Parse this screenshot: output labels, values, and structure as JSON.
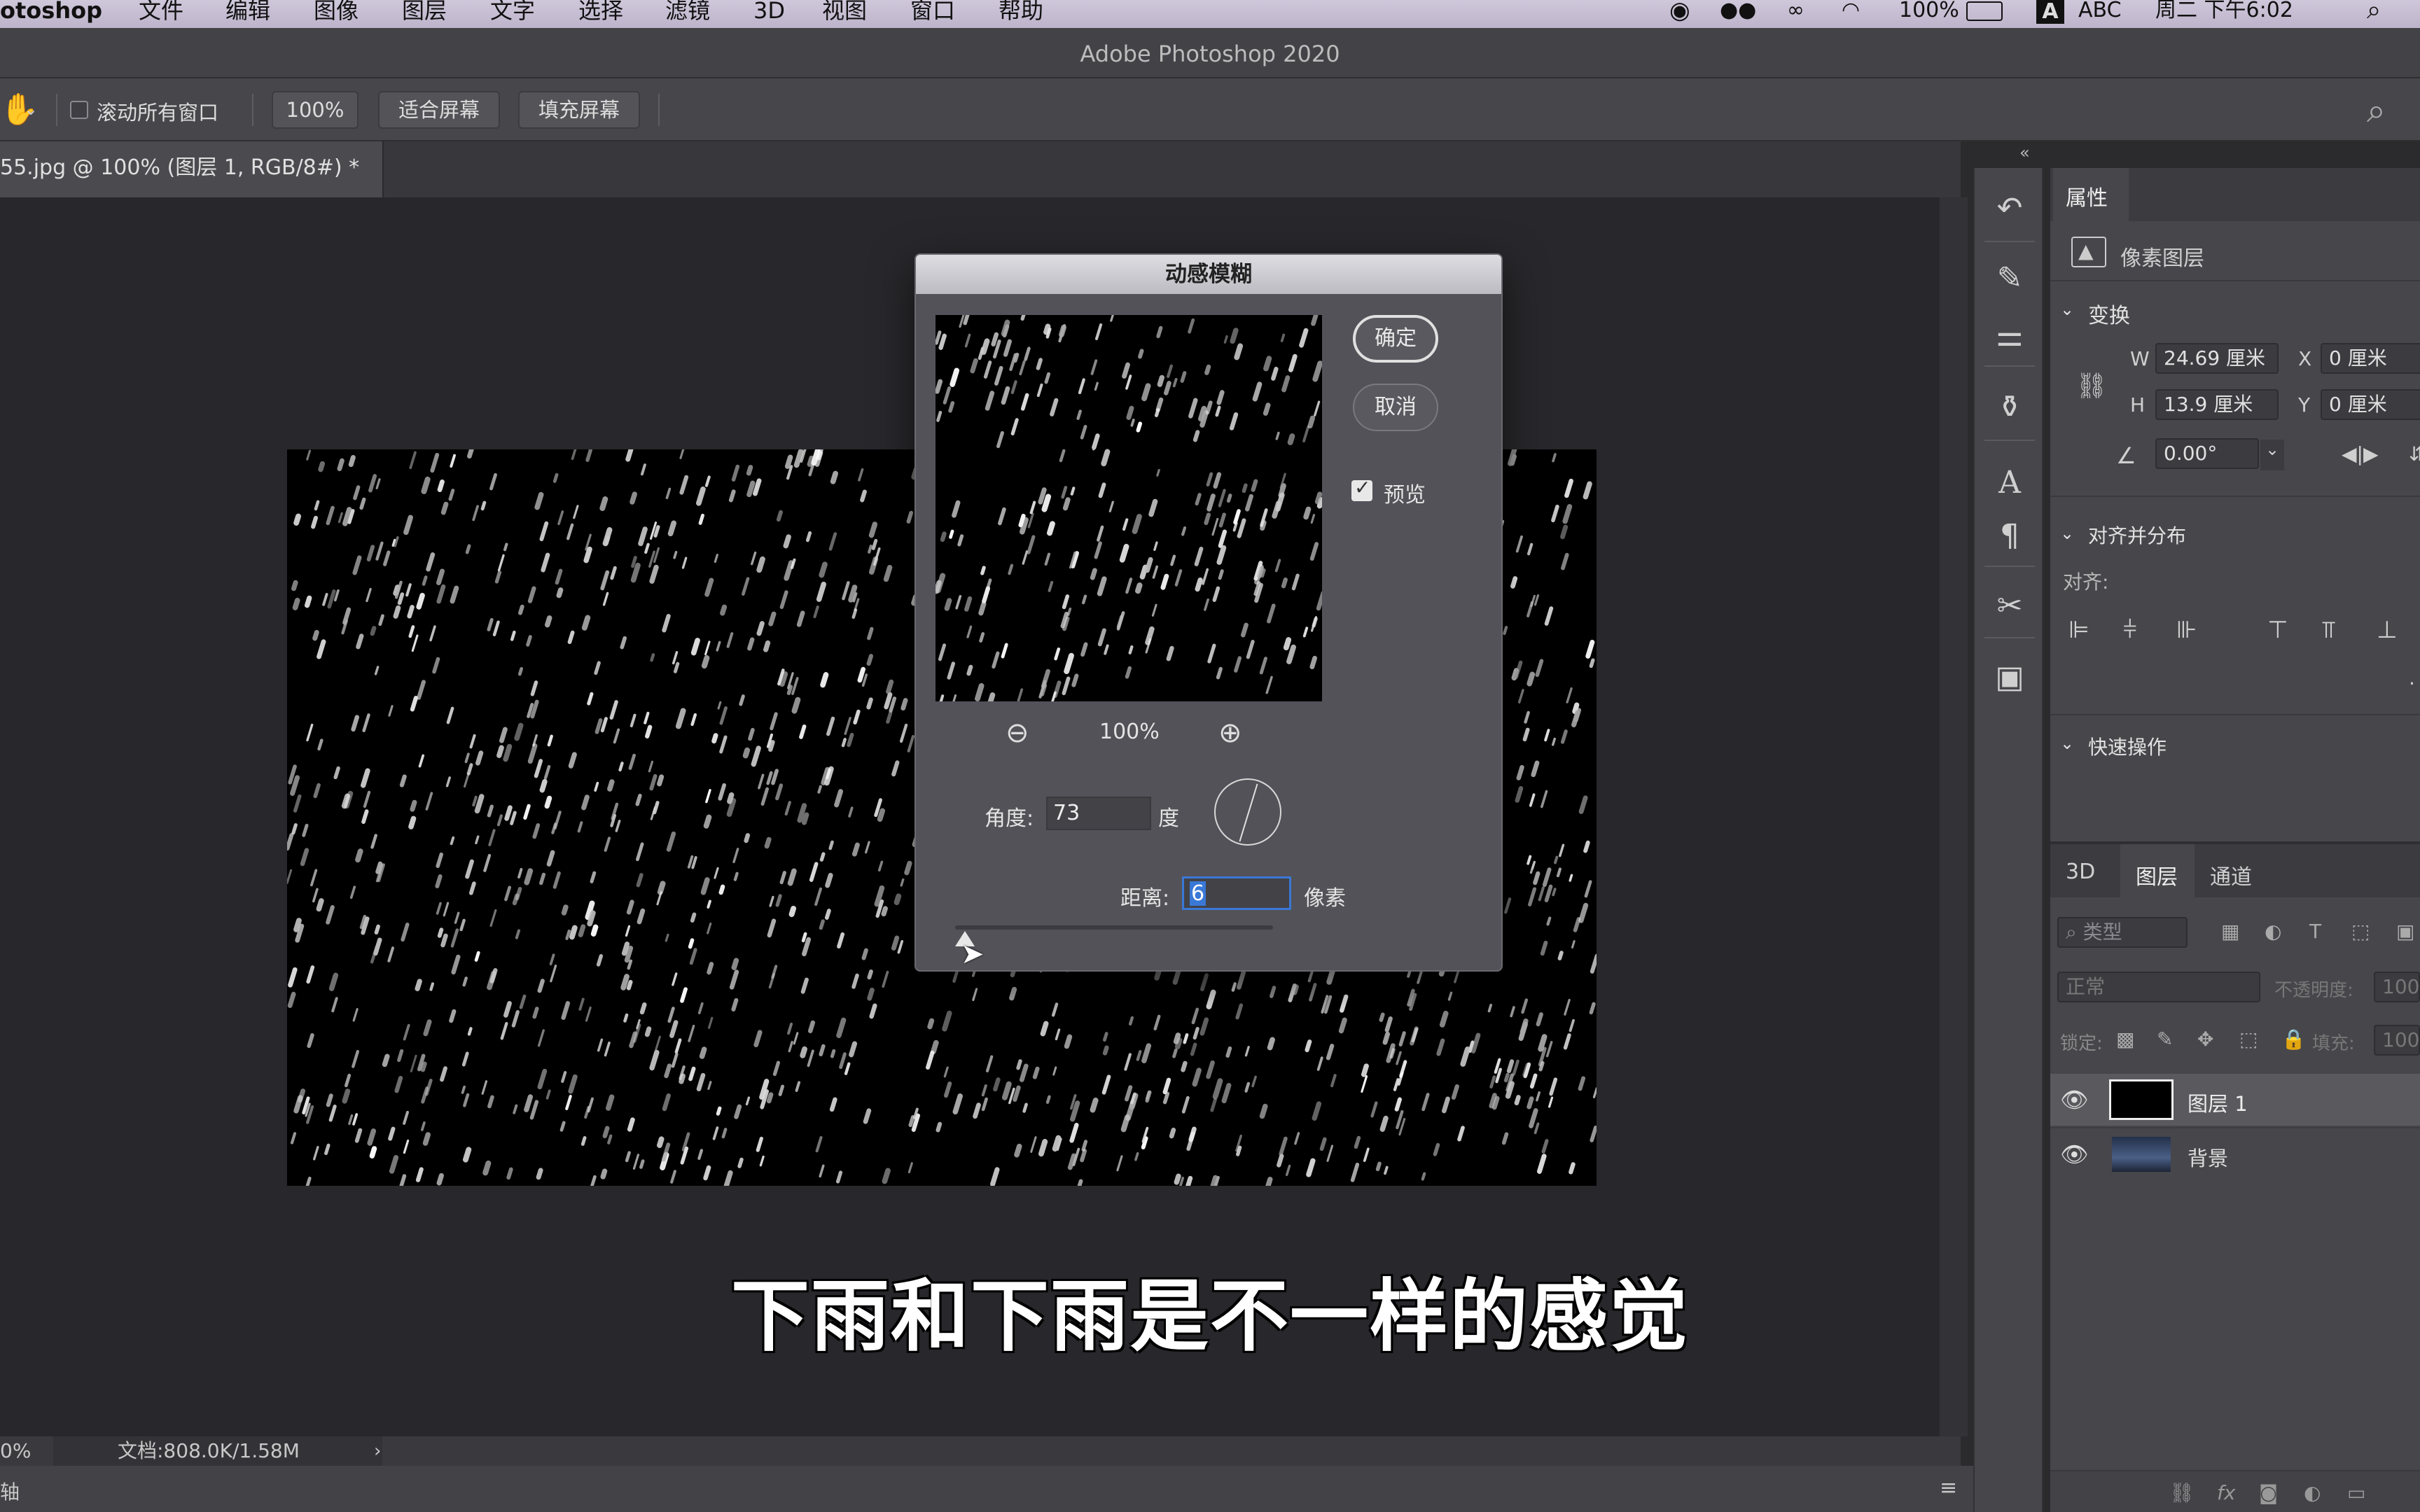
{
  "menubar": {
    "app": "otoshop",
    "items": [
      "文件",
      "编辑",
      "图像",
      "图层",
      "文字",
      "选择",
      "滤镜",
      "3D",
      "视图",
      "窗口",
      "帮助"
    ],
    "battery": "100%",
    "input_source": "ABC",
    "clock": "周二 下午6:02"
  },
  "window": {
    "title": "Adobe Photoshop 2020"
  },
  "options": {
    "scroll_all_label": "滚动所有窗口",
    "zoom_btn": "100%",
    "fit_btn": "适合屏幕",
    "fill_btn": "填充屏幕"
  },
  "document": {
    "tab_label": "55.jpg @ 100% (图层 1, RGB/8#) *"
  },
  "status": {
    "zoom": "0%",
    "doc_info": "文档:808.0K/1.58M",
    "bottom_label": "轴"
  },
  "subtitle": "下雨和下雨是不一样的感觉",
  "dialog": {
    "title": "动感模糊",
    "ok": "确定",
    "cancel": "取消",
    "preview_label": "预览",
    "preview_checked": true,
    "zoom": "100%",
    "angle_label": "角度:",
    "angle_value": "73",
    "angle_unit": "度",
    "distance_label": "距离:",
    "distance_value": "6",
    "distance_unit": "像素"
  },
  "properties": {
    "tab": "属性",
    "layer_type": "像素图层",
    "transform_header": "变换",
    "w_label": "W",
    "w_value": "24.69 厘米",
    "x_label": "X",
    "x_value": "0 厘米",
    "h_label": "H",
    "h_value": "13.9 厘米",
    "y_label": "Y",
    "y_value": "0 厘米",
    "angle_value": "0.00°",
    "align_header": "对齐并分布",
    "align_label": "对齐:",
    "quick_header": "快速操作"
  },
  "layers_panel": {
    "tabs": [
      "3D",
      "图层",
      "通道"
    ],
    "active_tab": "图层",
    "search_placeholder": "类型",
    "blend_mode": "正常",
    "opacity_label": "不透明度:",
    "opacity_value": "100",
    "lock_label": "锁定:",
    "fill_label": "填充:",
    "fill_value": "100",
    "layers": [
      {
        "name": "图层 1",
        "selected": true
      },
      {
        "name": "背景",
        "selected": false
      }
    ]
  },
  "colors": {
    "accent_blue": "#3a78d6",
    "panel_bg": "#47464b",
    "canvas_bg": "#28272b"
  }
}
